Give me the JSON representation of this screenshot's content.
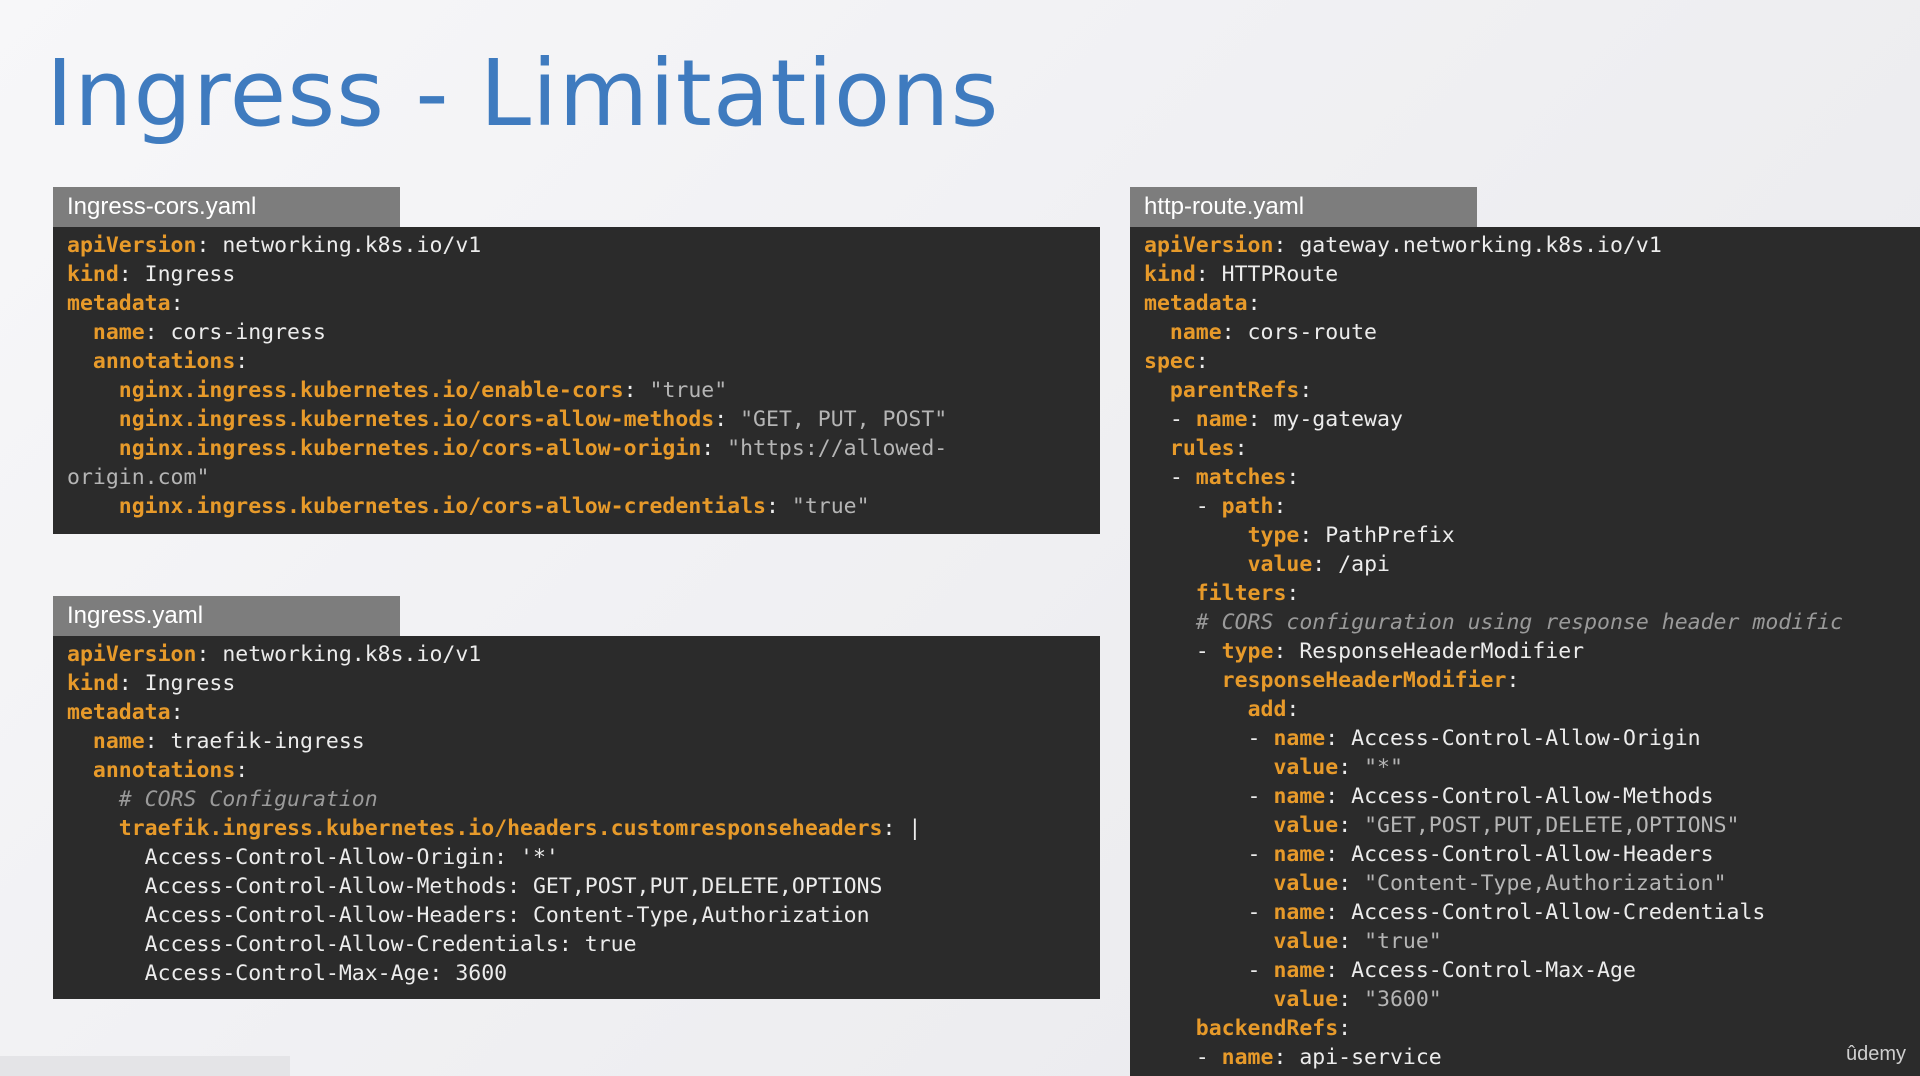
{
  "slide": {
    "title": "Ingress - Limitations",
    "logo": "ûdemy"
  },
  "panels": {
    "cors_ingress": {
      "filename": "Ingress-cors.yaml",
      "lines": [
        [
          {
            "t": "apiVersion",
            "c": "k"
          },
          {
            "t": ": networking.k8s.io/v1"
          }
        ],
        [
          {
            "t": "kind",
            "c": "k"
          },
          {
            "t": ": Ingress"
          }
        ],
        [
          {
            "t": "metadata",
            "c": "k"
          },
          {
            "t": ":"
          }
        ],
        [
          {
            "t": "  "
          },
          {
            "t": "name",
            "c": "k"
          },
          {
            "t": ": cors-ingress"
          }
        ],
        [
          {
            "t": "  "
          },
          {
            "t": "annotations",
            "c": "k"
          },
          {
            "t": ":"
          }
        ],
        [
          {
            "t": "    "
          },
          {
            "t": "nginx.ingress.kubernetes.io/enable-cors",
            "c": "k"
          },
          {
            "t": ": "
          },
          {
            "t": "\"true\"",
            "c": "s"
          }
        ],
        [
          {
            "t": "    "
          },
          {
            "t": "nginx.ingress.kubernetes.io/cors-allow-methods",
            "c": "k"
          },
          {
            "t": ": "
          },
          {
            "t": "\"GET, PUT, POST\"",
            "c": "s"
          }
        ],
        [
          {
            "t": "    "
          },
          {
            "t": "nginx.ingress.kubernetes.io/cors-allow-origin",
            "c": "k"
          },
          {
            "t": ": "
          },
          {
            "t": "\"https://allowed-",
            "c": "s"
          }
        ],
        [
          {
            "t": "origin.com\"",
            "c": "s"
          }
        ],
        [
          {
            "t": "    "
          },
          {
            "t": "nginx.ingress.kubernetes.io/cors-allow-credentials",
            "c": "k"
          },
          {
            "t": ": "
          },
          {
            "t": "\"true\"",
            "c": "s"
          }
        ]
      ]
    },
    "traefik_ingress": {
      "filename": "Ingress.yaml",
      "lines": [
        [
          {
            "t": "apiVersion",
            "c": "k"
          },
          {
            "t": ": networking.k8s.io/v1"
          }
        ],
        [
          {
            "t": "kind",
            "c": "k"
          },
          {
            "t": ": Ingress"
          }
        ],
        [
          {
            "t": "metadata",
            "c": "k"
          },
          {
            "t": ":"
          }
        ],
        [
          {
            "t": "  "
          },
          {
            "t": "name",
            "c": "k"
          },
          {
            "t": ": traefik-ingress"
          }
        ],
        [
          {
            "t": "  "
          },
          {
            "t": "annotations",
            "c": "k"
          },
          {
            "t": ":"
          }
        ],
        [
          {
            "t": "    "
          },
          {
            "t": "# CORS Configuration",
            "c": "c"
          }
        ],
        [
          {
            "t": "    "
          },
          {
            "t": "traefik.ingress.kubernetes.io/headers.customresponseheaders",
            "c": "k"
          },
          {
            "t": ": |"
          }
        ],
        [
          {
            "t": "      Access-Control-Allow-Origin: '*'"
          }
        ],
        [
          {
            "t": "      Access-Control-Allow-Methods: GET,POST,PUT,DELETE,OPTIONS"
          }
        ],
        [
          {
            "t": "      Access-Control-Allow-Headers: Content-Type,Authorization"
          }
        ],
        [
          {
            "t": "      Access-Control-Allow-Credentials: true"
          }
        ],
        [
          {
            "t": "      Access-Control-Max-Age: 3600"
          }
        ]
      ]
    },
    "http_route": {
      "filename": "http-route.yaml",
      "lines": [
        [
          {
            "t": "apiVersion",
            "c": "k"
          },
          {
            "t": ": gateway.networking.k8s.io/v1"
          }
        ],
        [
          {
            "t": "kind",
            "c": "k"
          },
          {
            "t": ": HTTPRoute"
          }
        ],
        [
          {
            "t": "metadata",
            "c": "k"
          },
          {
            "t": ":"
          }
        ],
        [
          {
            "t": "  "
          },
          {
            "t": "name",
            "c": "k"
          },
          {
            "t": ": cors-route"
          }
        ],
        [
          {
            "t": "spec",
            "c": "k"
          },
          {
            "t": ":"
          }
        ],
        [
          {
            "t": "  "
          },
          {
            "t": "parentRefs",
            "c": "k"
          },
          {
            "t": ":"
          }
        ],
        [
          {
            "t": "  - "
          },
          {
            "t": "name",
            "c": "k"
          },
          {
            "t": ": my-gateway"
          }
        ],
        [
          {
            "t": "  "
          },
          {
            "t": "rules",
            "c": "k"
          },
          {
            "t": ":"
          }
        ],
        [
          {
            "t": "  - "
          },
          {
            "t": "matches",
            "c": "k"
          },
          {
            "t": ":"
          }
        ],
        [
          {
            "t": "    - "
          },
          {
            "t": "path",
            "c": "k"
          },
          {
            "t": ":"
          }
        ],
        [
          {
            "t": "        "
          },
          {
            "t": "type",
            "c": "k"
          },
          {
            "t": ": PathPrefix"
          }
        ],
        [
          {
            "t": "        "
          },
          {
            "t": "value",
            "c": "k"
          },
          {
            "t": ": /api"
          }
        ],
        [
          {
            "t": "    "
          },
          {
            "t": "filters",
            "c": "k"
          },
          {
            "t": ":"
          }
        ],
        [
          {
            "t": "    "
          },
          {
            "t": "# CORS configuration using response header modific",
            "c": "c"
          }
        ],
        [
          {
            "t": "    - "
          },
          {
            "t": "type",
            "c": "k"
          },
          {
            "t": ": ResponseHeaderModifier"
          }
        ],
        [
          {
            "t": "      "
          },
          {
            "t": "responseHeaderModifier",
            "c": "k"
          },
          {
            "t": ":"
          }
        ],
        [
          {
            "t": "        "
          },
          {
            "t": "add",
            "c": "k"
          },
          {
            "t": ":"
          }
        ],
        [
          {
            "t": "        - "
          },
          {
            "t": "name",
            "c": "k"
          },
          {
            "t": ": Access-Control-Allow-Origin"
          }
        ],
        [
          {
            "t": "          "
          },
          {
            "t": "value",
            "c": "k"
          },
          {
            "t": ": "
          },
          {
            "t": "\"*\"",
            "c": "s"
          }
        ],
        [
          {
            "t": "        - "
          },
          {
            "t": "name",
            "c": "k"
          },
          {
            "t": ": Access-Control-Allow-Methods"
          }
        ],
        [
          {
            "t": "          "
          },
          {
            "t": "value",
            "c": "k"
          },
          {
            "t": ": "
          },
          {
            "t": "\"GET,POST,PUT,DELETE,OPTIONS\"",
            "c": "s"
          }
        ],
        [
          {
            "t": "        - "
          },
          {
            "t": "name",
            "c": "k"
          },
          {
            "t": ": Access-Control-Allow-Headers"
          }
        ],
        [
          {
            "t": "          "
          },
          {
            "t": "value",
            "c": "k"
          },
          {
            "t": ": "
          },
          {
            "t": "\"Content-Type,Authorization\"",
            "c": "s"
          }
        ],
        [
          {
            "t": "        - "
          },
          {
            "t": "name",
            "c": "k"
          },
          {
            "t": ": Access-Control-Allow-Credentials"
          }
        ],
        [
          {
            "t": "          "
          },
          {
            "t": "value",
            "c": "k"
          },
          {
            "t": ": "
          },
          {
            "t": "\"true\"",
            "c": "s"
          }
        ],
        [
          {
            "t": "        - "
          },
          {
            "t": "name",
            "c": "k"
          },
          {
            "t": ": Access-Control-Max-Age"
          }
        ],
        [
          {
            "t": "          "
          },
          {
            "t": "value",
            "c": "k"
          },
          {
            "t": ": "
          },
          {
            "t": "\"3600\"",
            "c": "s"
          }
        ],
        [
          {
            "t": "    "
          },
          {
            "t": "backendRefs",
            "c": "k"
          },
          {
            "t": ":"
          }
        ],
        [
          {
            "t": "    - "
          },
          {
            "t": "name",
            "c": "k"
          },
          {
            "t": ": api-service"
          }
        ]
      ]
    }
  }
}
